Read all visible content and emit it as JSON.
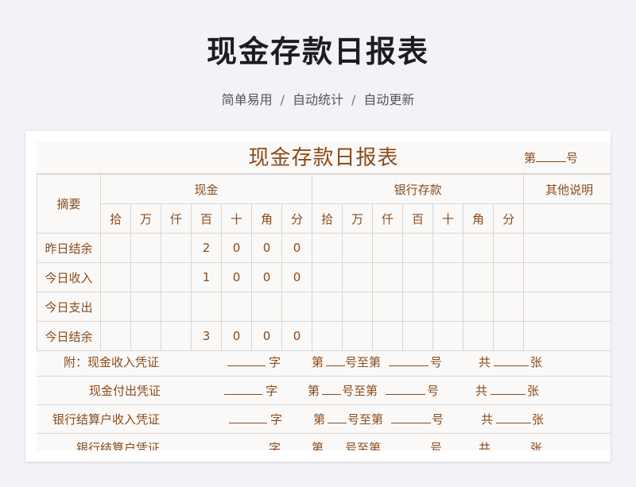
{
  "header": {
    "title": "现金存款日报表",
    "subtitle_parts": [
      "简单易用",
      "自动统计",
      "自动更新"
    ],
    "separator": "/"
  },
  "sheet": {
    "title": "现金存款日报表",
    "number_prefix": "第",
    "number_suffix": "号",
    "col_summary": "摘要",
    "group_cash": "现金",
    "group_bank": "银行存款",
    "group_other": "其他说明",
    "digits": [
      "拾",
      "万",
      "仟",
      "百",
      "十",
      "角",
      "分"
    ],
    "rows": [
      {
        "label": "昨日结余",
        "cash": [
          "",
          "",
          "",
          "2",
          "0",
          "0",
          "0"
        ]
      },
      {
        "label": "今日收入",
        "cash": [
          "",
          "",
          "",
          "1",
          "0",
          "0",
          "0"
        ]
      },
      {
        "label": "今日支出",
        "cash": [
          "",
          "",
          "",
          "",
          "",
          "",
          ""
        ]
      },
      {
        "label": "今日结余",
        "cash": [
          "",
          "",
          "",
          "3",
          "0",
          "0",
          "0"
        ]
      }
    ],
    "notes": [
      {
        "label": "附：现金收入凭证",
        "zi": "字",
        "di": "第",
        "zhi": "号至第",
        "hao": "号",
        "gong": "共",
        "zhang": "张"
      },
      {
        "label": "现金付出凭证",
        "zi": "字",
        "di": "第",
        "zhi": "号至第",
        "hao": "号",
        "gong": "共",
        "zhang": "张"
      },
      {
        "label": "银行结算户收入凭证",
        "zi": "字",
        "di": "第",
        "zhi": "号至第",
        "hao": "号",
        "gong": "共",
        "zhang": "张"
      },
      {
        "label": "银行结算户凭证",
        "zi": "字",
        "di": "第",
        "zhi": "号至第",
        "hao": "号",
        "gong": "共",
        "zhang": "张"
      }
    ]
  }
}
